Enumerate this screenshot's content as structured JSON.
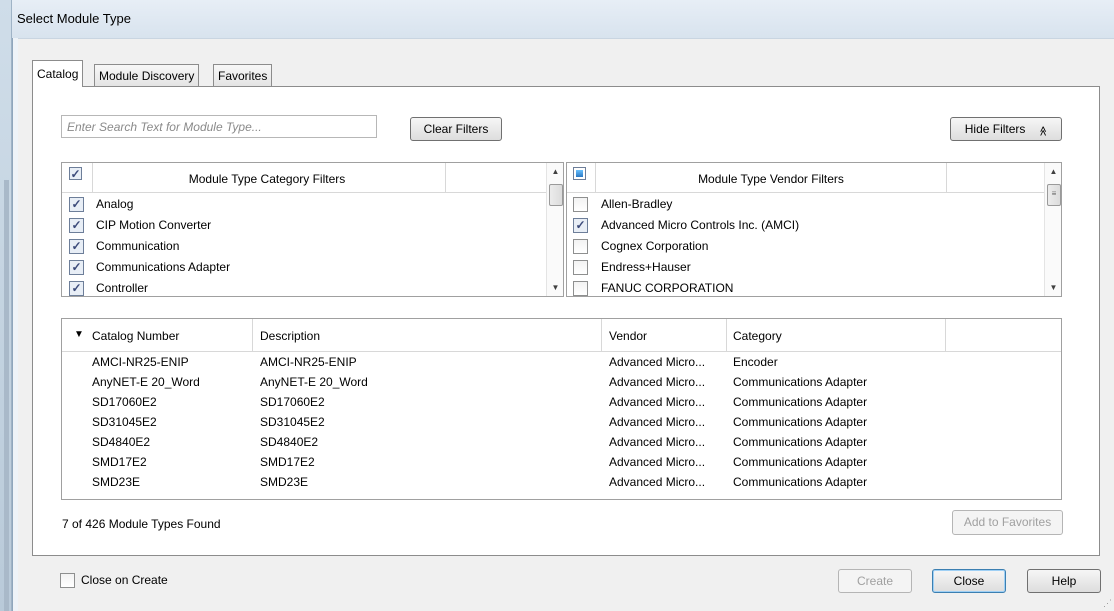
{
  "window": {
    "title": "Select Module Type"
  },
  "tabs": [
    {
      "label": "Catalog",
      "active": true
    },
    {
      "label": "Module Discovery",
      "active": false
    },
    {
      "label": "Favorites",
      "active": false
    }
  ],
  "search": {
    "placeholder": "Enter Search Text for Module Type..."
  },
  "buttons": {
    "clear_filters": "Clear Filters",
    "hide_filters": "Hide Filters",
    "hide_filters_icon": "≪",
    "add_to_favorites": "Add to Favorites",
    "create": "Create",
    "close": "Close",
    "help": "Help"
  },
  "category_filters": {
    "title": "Module Type Category Filters",
    "header_checked": true,
    "items": [
      {
        "label": "Analog",
        "checked": true
      },
      {
        "label": "CIP Motion Converter",
        "checked": true
      },
      {
        "label": "Communication",
        "checked": true
      },
      {
        "label": "Communications Adapter",
        "checked": true
      },
      {
        "label": "Controller",
        "checked": true
      }
    ]
  },
  "vendor_filters": {
    "title": "Module Type Vendor Filters",
    "header_state": "partial",
    "items": [
      {
        "label": "Allen-Bradley",
        "checked": false
      },
      {
        "label": "Advanced Micro Controls Inc. (AMCI)",
        "checked": true
      },
      {
        "label": "Cognex Corporation",
        "checked": false
      },
      {
        "label": "Endress+Hauser",
        "checked": false
      },
      {
        "label": "FANUC CORPORATION",
        "checked": false
      }
    ]
  },
  "results": {
    "columns": [
      "Catalog Number",
      "Description",
      "Vendor",
      "Category"
    ],
    "sort_icon": "▼",
    "rows": [
      {
        "catalog": "AMCI-NR25-ENIP",
        "description": "AMCI-NR25-ENIP",
        "vendor": "Advanced Micro...",
        "category": "Encoder"
      },
      {
        "catalog": "AnyNET-E 20_Word",
        "description": "AnyNET-E 20_Word",
        "vendor": "Advanced Micro...",
        "category": "Communications Adapter"
      },
      {
        "catalog": "SD17060E2",
        "description": "SD17060E2",
        "vendor": "Advanced Micro...",
        "category": "Communications Adapter"
      },
      {
        "catalog": "SD31045E2",
        "description": "SD31045E2",
        "vendor": "Advanced Micro...",
        "category": "Communications Adapter"
      },
      {
        "catalog": "SD4840E2",
        "description": "SD4840E2",
        "vendor": "Advanced Micro...",
        "category": "Communications Adapter"
      },
      {
        "catalog": "SMD17E2",
        "description": "SMD17E2",
        "vendor": "Advanced Micro...",
        "category": "Communications Adapter"
      },
      {
        "catalog": "SMD23E",
        "description": "SMD23E",
        "vendor": "Advanced Micro...",
        "category": "Communications Adapter"
      }
    ]
  },
  "status": {
    "found_text": "7 of 426 Module Types Found"
  },
  "footer": {
    "close_on_create_label": "Close on Create",
    "close_on_create_checked": false
  },
  "colors": {
    "accent": "#3c7fb1",
    "title_bar": "#dbe6f1",
    "checkbox_fill": "#2b78c4"
  }
}
